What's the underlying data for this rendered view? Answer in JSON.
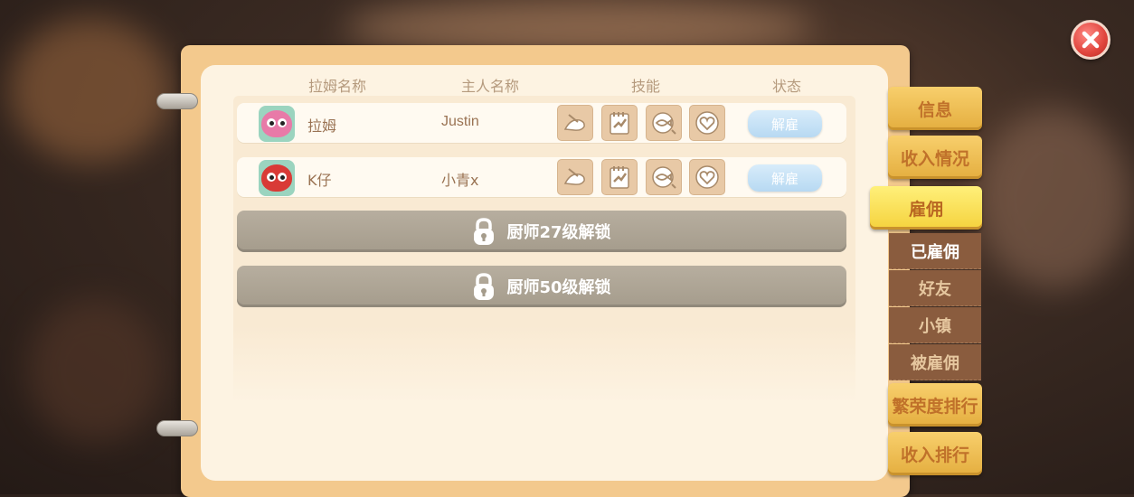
{
  "table": {
    "headers": [
      "拉姆名称",
      "主人名称",
      "技能",
      "状态"
    ],
    "rows": [
      {
        "lamu_name": "拉姆",
        "owner_name": "Justin",
        "skills": [
          "fishing-icon",
          "clipboard-icon",
          "fish-pan-icon",
          "heart-icon"
        ],
        "status_button": "解雇",
        "avatar_color": "#e87aa8"
      },
      {
        "lamu_name": "K仔",
        "owner_name": "小青x",
        "skills": [
          "fishing-icon",
          "clipboard-icon",
          "fish-pan-icon",
          "heart-icon"
        ],
        "status_button": "解雇",
        "avatar_color": "#d93a36"
      }
    ],
    "locked_slots": [
      "厨师27级解锁",
      "厨师50级解锁"
    ]
  },
  "tabs": {
    "info": "信息",
    "income": "收入情况",
    "hire": "雇佣",
    "hire_sub": [
      "已雇佣",
      "好友",
      "小镇",
      "被雇佣"
    ],
    "prosperity_rank": "繁荣度排行",
    "income_rank": "收入排行"
  },
  "colors": {
    "accent_tab": "#f5d23d",
    "tab": "#e4ae3f",
    "fire_button": "#b7d9f2",
    "locked_slot": "#a59c8c"
  }
}
